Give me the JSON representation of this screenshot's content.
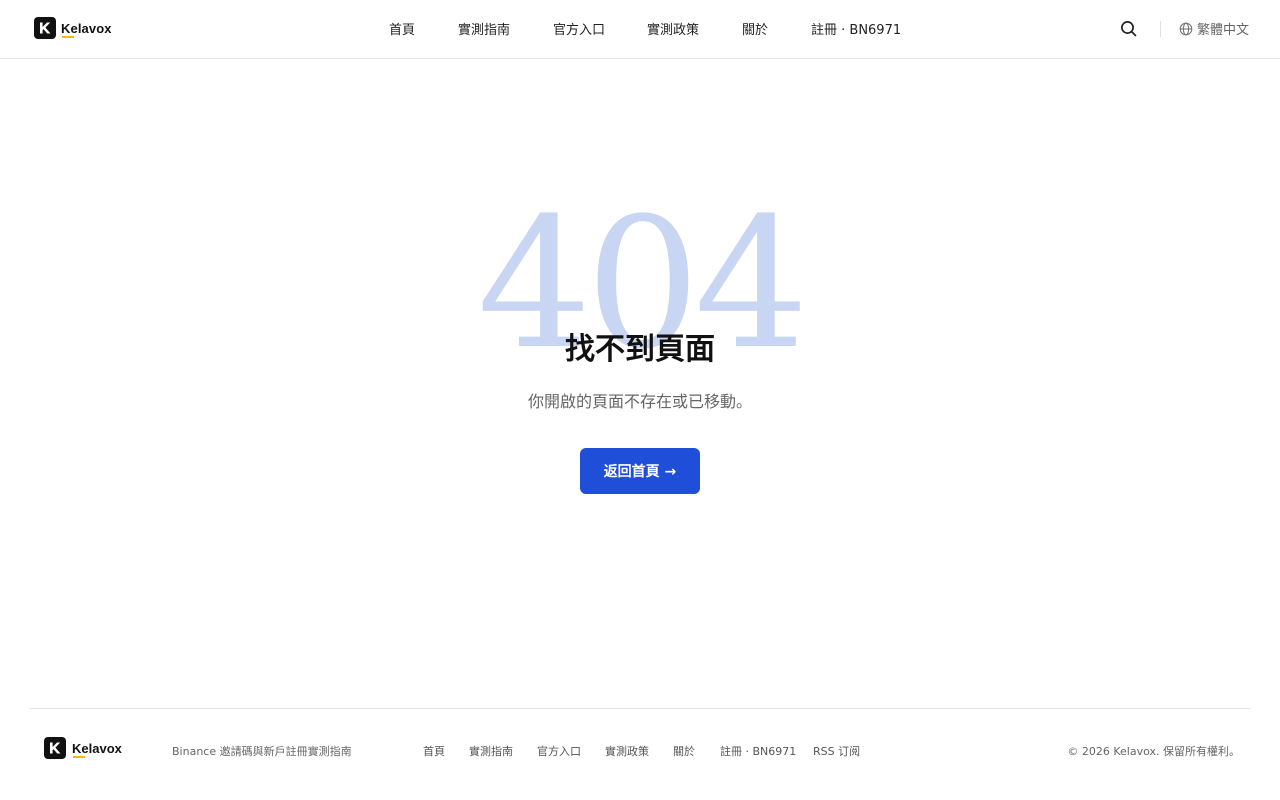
{
  "header": {
    "brand": "Kelavox",
    "nav": [
      "首頁",
      "實測指南",
      "官方入口",
      "實測政策",
      "關於",
      "註冊 · BN6971"
    ],
    "language": "繁體中文"
  },
  "main": {
    "code": "404",
    "title": "找不到頁面",
    "subtitle": "你開啟的頁面不存在或已移動。",
    "button_label": "返回首頁 →"
  },
  "footer": {
    "brand": "Kelavox",
    "tagline": "Binance 邀請碼與新戶註冊實測指南",
    "nav": [
      "首頁",
      "實測指南",
      "官方入口",
      "實測政策",
      "關於",
      "註冊 · BN6971",
      "RSS 订阅"
    ],
    "copyright": "© 2026 Kelavox. 保留所有權利。"
  },
  "colors": {
    "primary": "#1f4fd8",
    "accent_underline": "#f0b90b",
    "code_watermark": "#c9d6f3"
  },
  "icons": {
    "logo": "k-logo-icon",
    "search": "search-icon",
    "language": "globe-icon"
  }
}
